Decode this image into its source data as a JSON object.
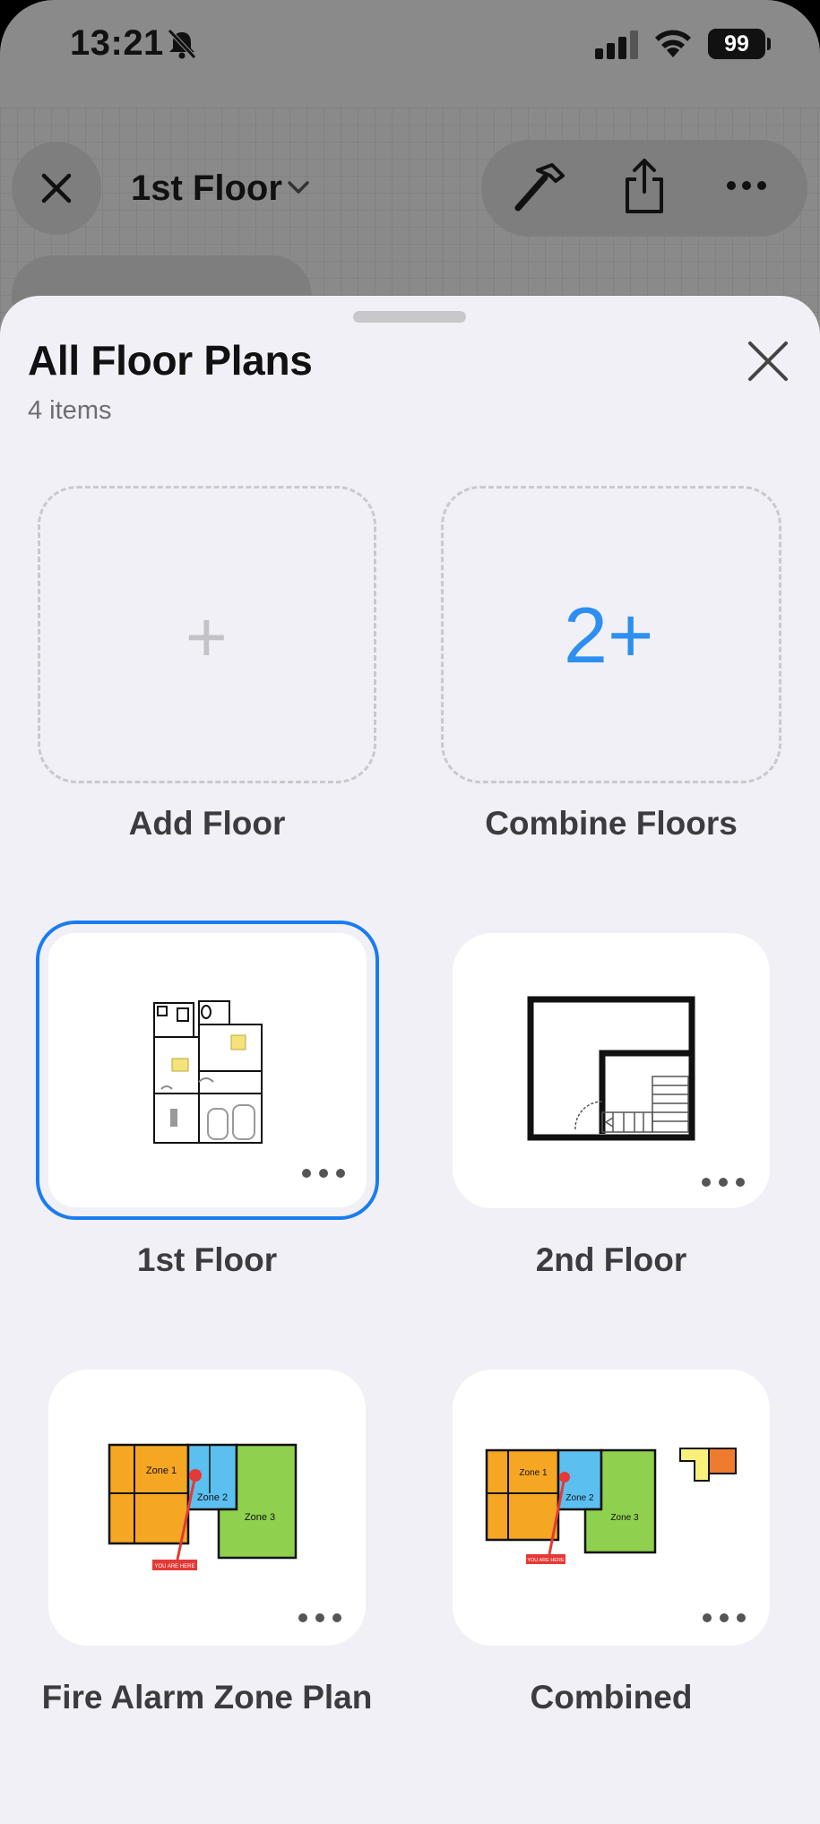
{
  "status_bar": {
    "time": "13:21",
    "battery": "99",
    "icons": [
      "bell-slash-icon",
      "cellular-signal-icon",
      "wifi-icon",
      "battery-icon"
    ]
  },
  "toolbar": {
    "current_floor": "1st Floor",
    "icons": [
      "close-icon",
      "chevron-down-icon",
      "hammer-icon",
      "share-icon",
      "more-icon"
    ]
  },
  "sheet": {
    "title": "All Floor Plans",
    "subtitle": "4 items",
    "actions": [
      {
        "label": "Add Floor",
        "glyph": "+"
      },
      {
        "label": "Combine Floors",
        "glyph": "2+"
      }
    ],
    "floors": [
      {
        "label": "1st Floor",
        "selected": true,
        "thumbnail": "house-floorplan-thumbnail"
      },
      {
        "label": "2nd Floor",
        "selected": false,
        "thumbnail": "room-stairs-floorplan-thumbnail"
      },
      {
        "label": "Fire Alarm Zone Plan",
        "selected": false,
        "thumbnail": "fire-zone-floorplan-thumbnail",
        "zones": [
          "Zone 1",
          "Zone 2",
          "Zone 3"
        ],
        "marker_text": "YOU ARE HERE"
      },
      {
        "label": "Combined",
        "selected": false,
        "thumbnail": "combined-floorplan-thumbnail",
        "zones": [
          "Zone 1",
          "Zone 2",
          "Zone 3"
        ],
        "marker_text": "YOU ARE HERE"
      }
    ]
  },
  "colors": {
    "accent": "#1a7cf0",
    "zone1": "#f5a623",
    "zone2": "#5bc0f0",
    "zone3": "#8fd14f",
    "marker": "#e53935"
  }
}
